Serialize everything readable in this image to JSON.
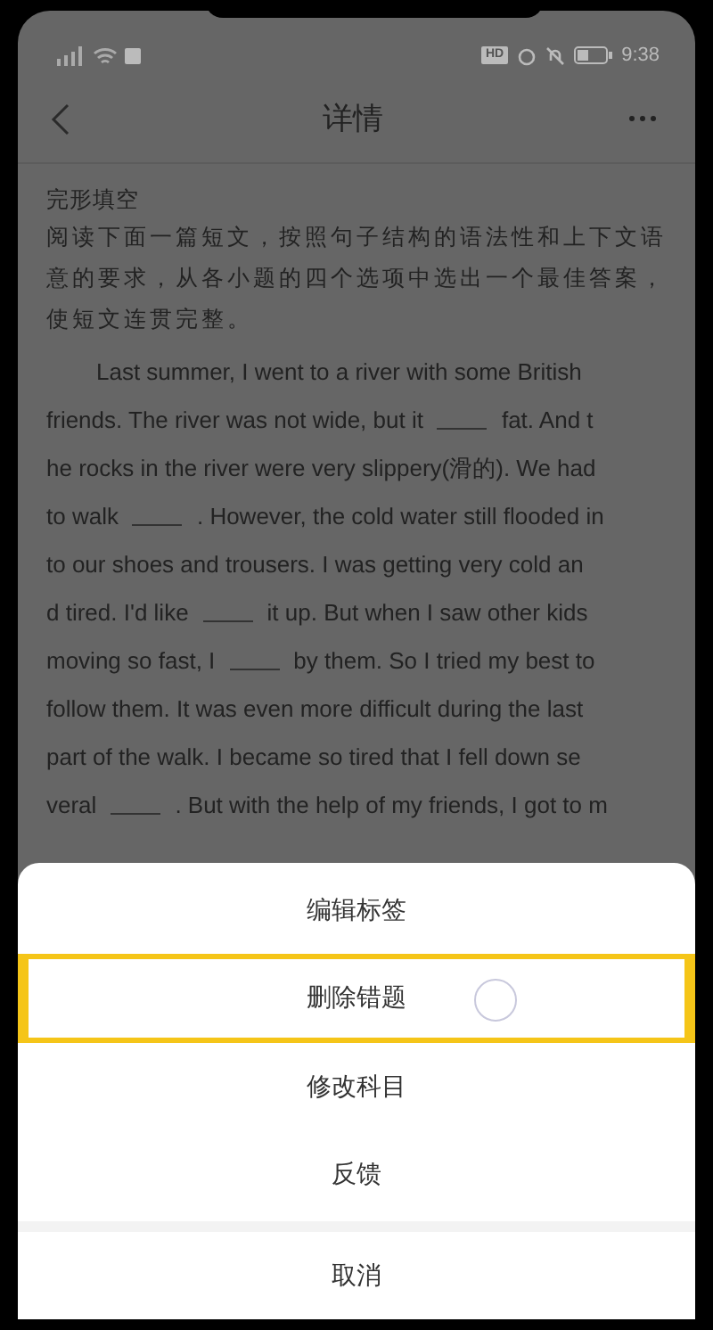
{
  "status_bar": {
    "time": "9:38",
    "hd": "HD"
  },
  "header": {
    "title": "详情"
  },
  "question": {
    "type_label": "完形填空",
    "instructions": "阅读下面一篇短文，按照句子结构的语法性和上下文语意的要求，从各小题的四个选项中选出一个最佳答案，使短文连贯完整。",
    "lines": [
      [
        {
          "kind": "text",
          "text": "Last summer, I went to a river with some British"
        }
      ],
      [
        {
          "kind": "text",
          "text": "friends. The river was not wide, but it"
        },
        {
          "kind": "blank"
        },
        {
          "kind": "text",
          "text": "fat. And t"
        }
      ],
      [
        {
          "kind": "text",
          "text": "he rocks in the river were very slippery(滑的). We had"
        }
      ],
      [
        {
          "kind": "text",
          "text": "to walk"
        },
        {
          "kind": "blank"
        },
        {
          "kind": "text",
          "text": ". However, the cold water still flooded in"
        }
      ],
      [
        {
          "kind": "text",
          "text": "to our shoes and trousers. I was getting very cold an"
        }
      ],
      [
        {
          "kind": "text",
          "text": "d tired. I'd like"
        },
        {
          "kind": "blank"
        },
        {
          "kind": "text",
          "text": "it up. But when I saw other kids"
        }
      ],
      [
        {
          "kind": "text",
          "text": "moving so fast, I"
        },
        {
          "kind": "blank"
        },
        {
          "kind": "text",
          "text": "by them. So I tried my best to"
        }
      ],
      [
        {
          "kind": "text",
          "text": "follow them. It was even more difficult during the last"
        }
      ],
      [
        {
          "kind": "text",
          "text": "part of the walk. I became so tired that I fell down se"
        }
      ],
      [
        {
          "kind": "text",
          "text": "veral"
        },
        {
          "kind": "blank"
        },
        {
          "kind": "text",
          "text": ". But with the help of my friends, I got to m"
        }
      ]
    ]
  },
  "action_sheet": {
    "items": [
      {
        "label": "编辑标签",
        "selected": false
      },
      {
        "label": "删除错题",
        "selected": true
      },
      {
        "label": "修改科目",
        "selected": false
      },
      {
        "label": "反馈",
        "selected": false
      }
    ],
    "cancel": "取消"
  }
}
